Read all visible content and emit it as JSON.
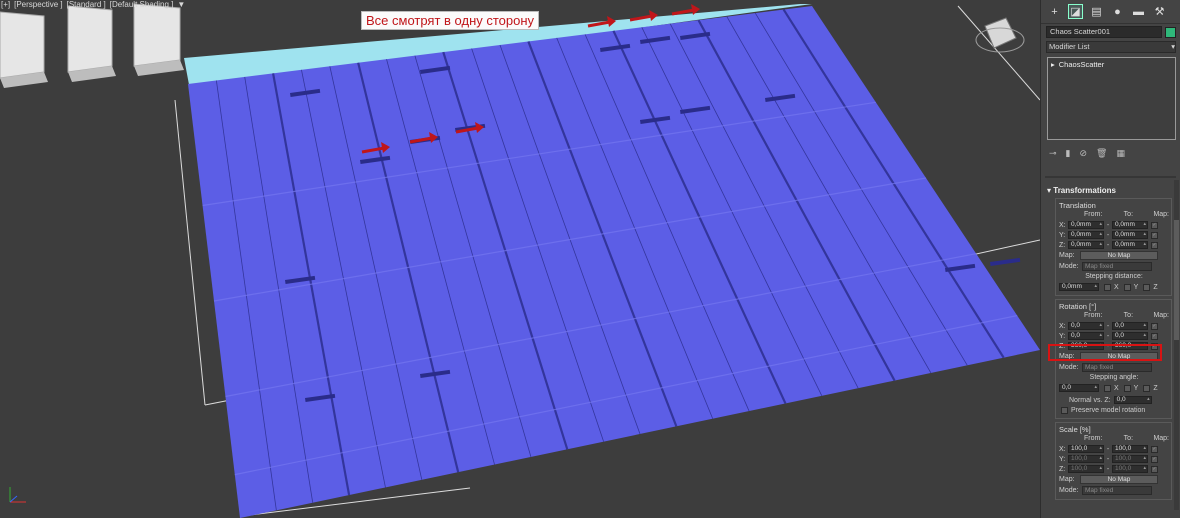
{
  "viewport": {
    "labels": [
      "[+]",
      "[Perspective ]",
      "[Standard ]",
      "[Default Shading ]"
    ],
    "annotation": "Все смотрят в одну сторону",
    "colors": {
      "background": "#3d3d3d",
      "plank": "#5c5ee6",
      "plank_light": "#7577f0",
      "plank_edge": "#2a2c8a",
      "cyan_strip": "#9fe3ef",
      "arrow": "#c0161a"
    }
  },
  "panel": {
    "tabs": [
      {
        "icon": "plus-icon",
        "glyph": "+"
      },
      {
        "icon": "modify-icon",
        "glyph": "◪"
      },
      {
        "icon": "hierarchy-icon",
        "glyph": "▤"
      },
      {
        "icon": "motion-icon",
        "glyph": "●"
      },
      {
        "icon": "display-icon",
        "glyph": "▬"
      },
      {
        "icon": "utilities-icon",
        "glyph": "⚒"
      }
    ],
    "object_name": "Chaos Scatter001",
    "object_color": "#2fb87a",
    "modifier_list": "Modifier List",
    "stack_item": "ChaosScatter",
    "rollout": "Transformations",
    "translation": {
      "title": "Translation",
      "from": "From:",
      "to": "To:",
      "map": "Map:",
      "rows": [
        {
          "axis": "X:",
          "from": "0,0mm",
          "to": "0,0mm"
        },
        {
          "axis": "Y:",
          "from": "0,0mm",
          "to": "0,0mm"
        },
        {
          "axis": "Z:",
          "from": "0,0mm",
          "to": "0,0mm"
        }
      ],
      "map_label": "Map:",
      "map_button": "No Map",
      "mode_label": "Mode:",
      "mode_value": "Map fixed",
      "stepping_label": "Stepping distance:",
      "stepping_value": "0,0mm",
      "x": "X",
      "y": "Y",
      "z": "Z"
    },
    "rotation": {
      "title": "Rotation [°]",
      "from": "From:",
      "to": "To:",
      "map": "Map:",
      "rows": [
        {
          "axis": "X:",
          "from": "0,0",
          "to": "0,0"
        },
        {
          "axis": "Y:",
          "from": "0,0",
          "to": "0,0"
        },
        {
          "axis": "Z:",
          "from": "360,0",
          "to": "360,0"
        }
      ],
      "map_label": "Map:",
      "map_button": "No Map",
      "mode_label": "Mode:",
      "mode_value": "Map fixed",
      "stepping_label": "Stepping angle:",
      "stepping_value": "0,0",
      "x": "X",
      "y": "Y",
      "z": "Z",
      "normal_label": "Normal vs. Z:",
      "normal_value": "0,0",
      "preserve_label": "Preserve model rotation"
    },
    "scale": {
      "title": "Scale [%]",
      "from": "From:",
      "to": "To:",
      "map": "Map:",
      "rows": [
        {
          "axis": "X:",
          "from": "100,0",
          "to": "100,0"
        },
        {
          "axis": "Y:",
          "from": "100,0",
          "to": "100,0"
        },
        {
          "axis": "Z:",
          "from": "100,0",
          "to": "100,0"
        }
      ],
      "map_label": "Map:",
      "map_button": "No Map",
      "mode_label": "Mode:",
      "mode_value": "Map fixed"
    }
  }
}
